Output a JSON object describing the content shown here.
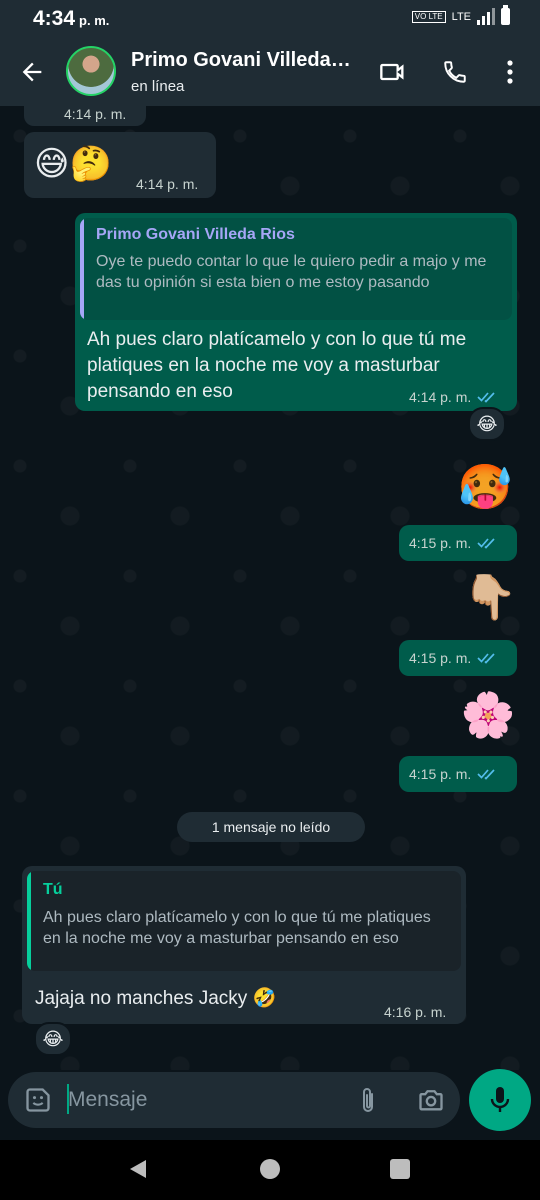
{
  "status_bar": {
    "time": "4:34",
    "ampm": "p. m.",
    "volte": "VO LTE",
    "lte": "LTE"
  },
  "header": {
    "contact_name": "Primo Govani Villeda…",
    "status": "en línea"
  },
  "messages": [
    {
      "type": "in-time-fragment",
      "time": "4:14 p. m."
    },
    {
      "type": "in",
      "emojis": "😅🤔",
      "time": "4:14 p. m."
    },
    {
      "type": "out",
      "quote_name": "Primo Govani Villeda Rios",
      "quote_text": "Oye te puedo contar lo que le quiero pedir a majo y me das tu opinión si esta bien o me estoy pasando",
      "text": "Ah pues claro platícamelo y con lo que tú me platiques en la noche me voy a masturbar pensando en eso",
      "time": "4:14 p. m.",
      "reaction": "😂"
    },
    {
      "type": "out-emoji",
      "emoji": "🥵",
      "time": "4:15 p. m."
    },
    {
      "type": "out-emoji",
      "emoji": "👇🏼",
      "time": "4:15 p. m."
    },
    {
      "type": "out-emoji",
      "emoji": "🌸",
      "time": "4:15 p. m."
    },
    {
      "type": "in",
      "quote_name": "Tú",
      "quote_text": "Ah pues claro platícamelo y con lo que tú me platiques en la noche me voy a masturbar pensando en eso",
      "text": "Jajaja no manches Jacky 🤣",
      "time": "4:16 p. m.",
      "reaction": "😂"
    }
  ],
  "unread_label": "1 mensaje no leído",
  "composer": {
    "placeholder": "Mensaje"
  },
  "colors": {
    "accent": "#00a884",
    "outgoing": "#005c4b",
    "incoming": "#1f2c34",
    "read_ticks": "#53bdeb"
  }
}
